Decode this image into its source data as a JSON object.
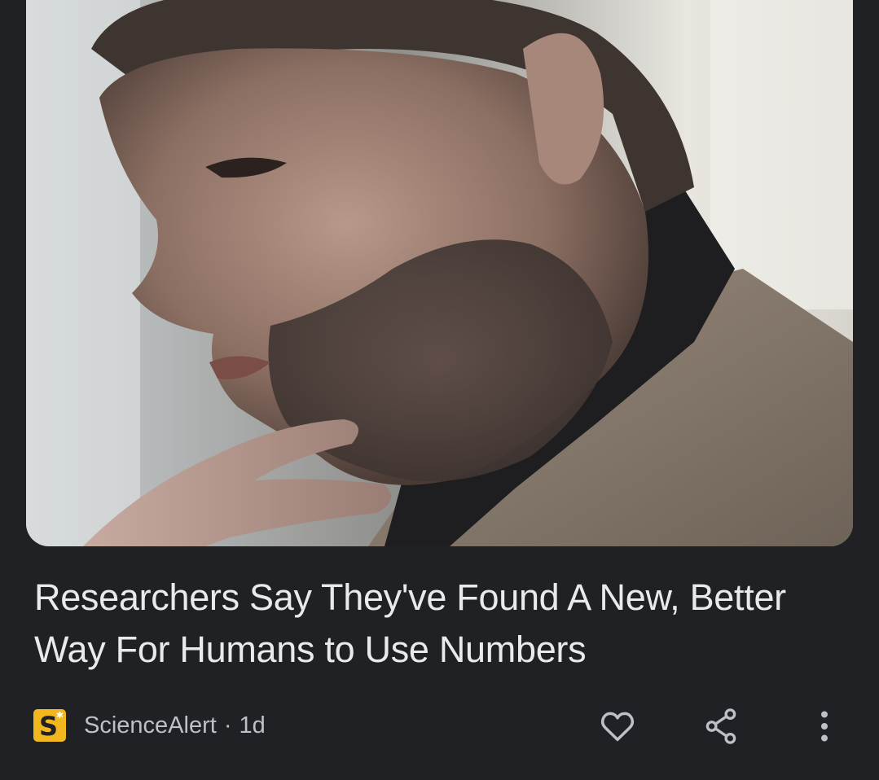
{
  "article": {
    "image_alt": "Man with beard touching chin thoughtfully",
    "headline": "Researchers Say They've Found A New, Better Way For Humans to Use Numbers",
    "source": {
      "logo_letter": "S",
      "name": "ScienceAlert",
      "separator": "·",
      "age": "1d"
    },
    "actions": {
      "like_icon": "heart-outline-icon",
      "share_icon": "share-icon",
      "more_icon": "more-vertical-icon"
    }
  },
  "colors": {
    "background": "#202124",
    "headline_text": "#e8eaed",
    "meta_text": "#bdc1c6",
    "source_logo_bg": "#f2b61f"
  }
}
